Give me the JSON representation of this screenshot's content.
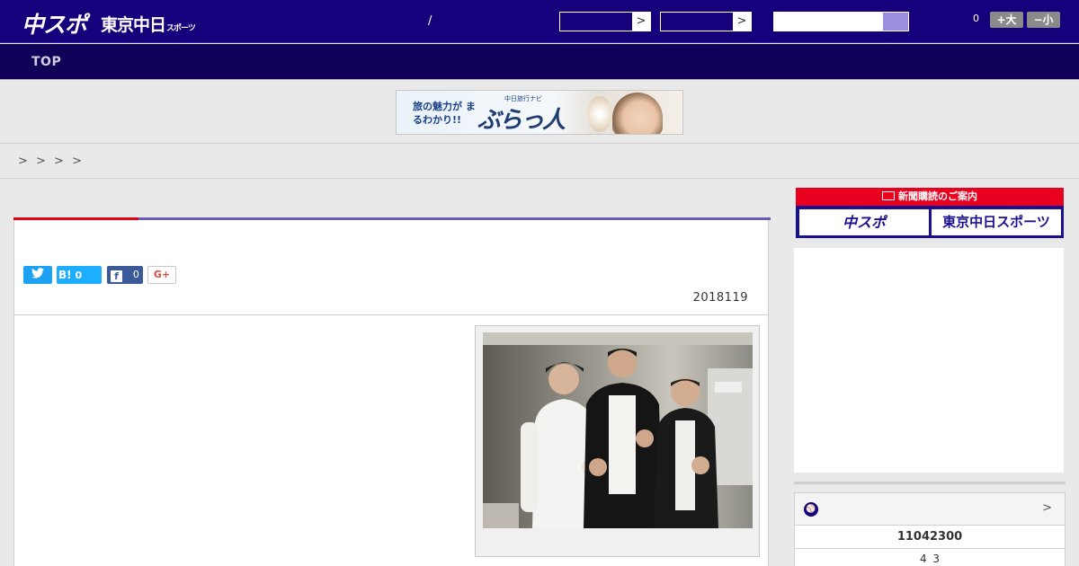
{
  "header": {
    "logo_chuspo": "中スポ",
    "logo_tokyo": "東京中日",
    "logo_tokyo_suffix": "スポーツ",
    "slash": "/",
    "select_arrow": ">",
    "notification_count": "0",
    "font_larger": "+大",
    "font_smaller": "−小"
  },
  "nav": {
    "top": "TOP"
  },
  "banner": {
    "headline": "旅の魅力が まるわかり!!",
    "brand_small": "中日旅行ナビ",
    "brand": "ぶらっ人"
  },
  "breadcrumb": {
    "text": "> > > >"
  },
  "article": {
    "share": {
      "twitter": "",
      "hatena_label": "B!",
      "hatena_count": "0",
      "facebook_icon": "f",
      "facebook_count": "0",
      "gplus": "G+"
    },
    "date": "2018119"
  },
  "sidebar": {
    "subscription_title": "新聞購読のご案内",
    "subscription_tiles": [
      "中スポ",
      "東京中日スポーツ"
    ],
    "score_more": ">",
    "score_main": "11042300",
    "score_sub": "4 3"
  },
  "colors": {
    "header_bg": "#17007c",
    "nav_bg": "#100058",
    "accent_red": "#e60012",
    "accent_purple": "#6c5bb8"
  }
}
